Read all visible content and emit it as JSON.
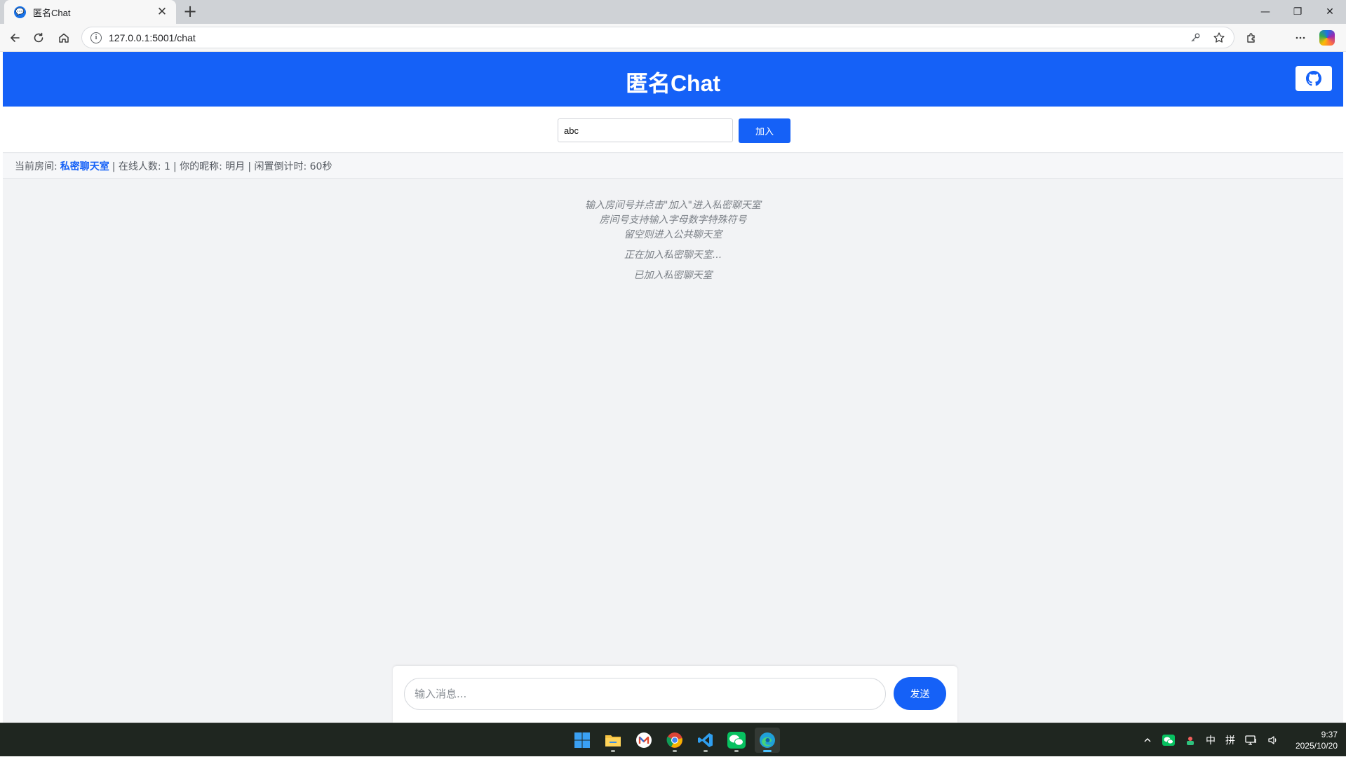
{
  "browser": {
    "tab_title": "匿名Chat",
    "tab_close": "✕",
    "new_tab": "+",
    "url": "127.0.0.1:5001/chat",
    "window_controls": {
      "minimize": "—",
      "restore": "❐",
      "close": "✕"
    }
  },
  "app": {
    "title": "匿名Chat",
    "room_input_value": "abc",
    "join_label": "加入",
    "status": {
      "room_label": "当前房间:",
      "room_name": "私密聊天室",
      "online_label": "| 在线人数: 1",
      "nickname_label": "| 你的昵称: 明月",
      "countdown_label": "| 闲置倒计时: 60秒"
    },
    "system_messages": {
      "intro_line1": "输入房间号并点击\"加入\"进入私密聊天室",
      "intro_line2": "房间号支持输入字母数字特殊符号",
      "intro_line3": "留空则进入公共聊天室",
      "joining": "正在加入私密聊天室...",
      "joined": "已加入私密聊天室"
    },
    "message_placeholder": "输入消息...",
    "send_label": "发送"
  },
  "taskbar": {
    "tray_ime_lang": "中",
    "tray_ime_mode": "拼",
    "tray_chevron": "^",
    "time": "9:37",
    "date": "2025/10/20"
  },
  "colors": {
    "brand_blue": "#1561f7",
    "status_room": "#1561f7",
    "taskbar_bg": "#1f2620"
  }
}
